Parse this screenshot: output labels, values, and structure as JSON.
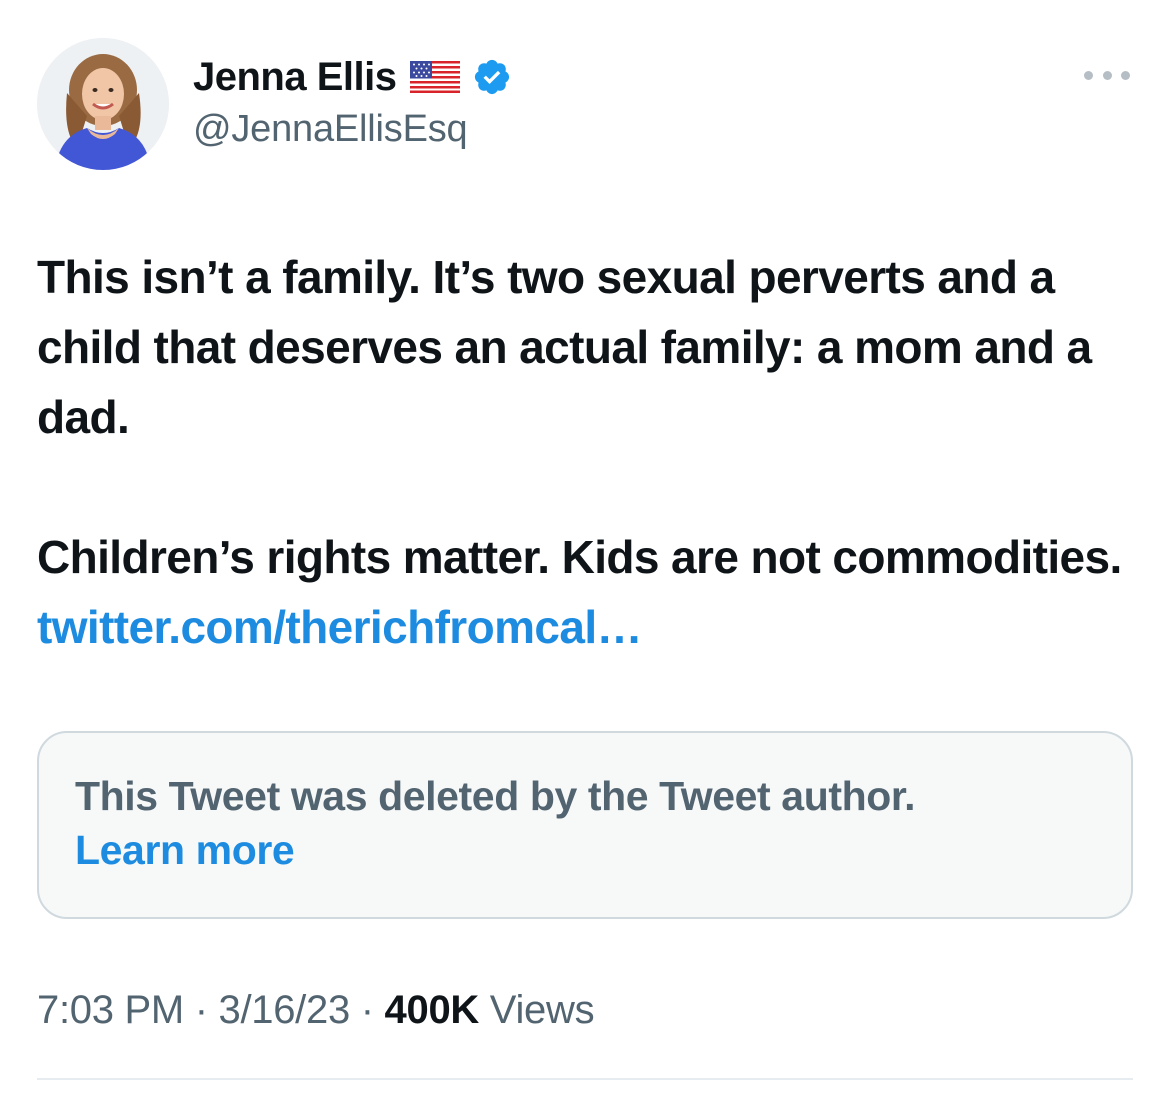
{
  "author": {
    "display_name": "Jenna Ellis",
    "handle": "@JennaEllisEsq",
    "flag_icon": "us-flag-emoji",
    "verified_icon": "verified-badge-icon",
    "verified_color": "#1d9bf0"
  },
  "tweet": {
    "paragraph1": "This isn’t a family. It’s two sexual perverts and a child that deserves an actual family: a mom and a dad.",
    "paragraph2_text": "Children’s rights matter. Kids are not commodities. ",
    "paragraph2_link": "twitter.com/therichfromcal…"
  },
  "quoted": {
    "deleted_message": "This Tweet was deleted by the Tweet author.",
    "learn_more_label": "Learn more"
  },
  "meta": {
    "time": "7:03 PM",
    "separator": " · ",
    "date": "3/16/23",
    "views_count": "400K",
    "views_label": " Views"
  },
  "colors": {
    "text": "#0f1419",
    "secondary": "#536471",
    "link": "#1d8ce0",
    "quote_bg": "#f7f9f9",
    "border": "#cfd9de"
  }
}
